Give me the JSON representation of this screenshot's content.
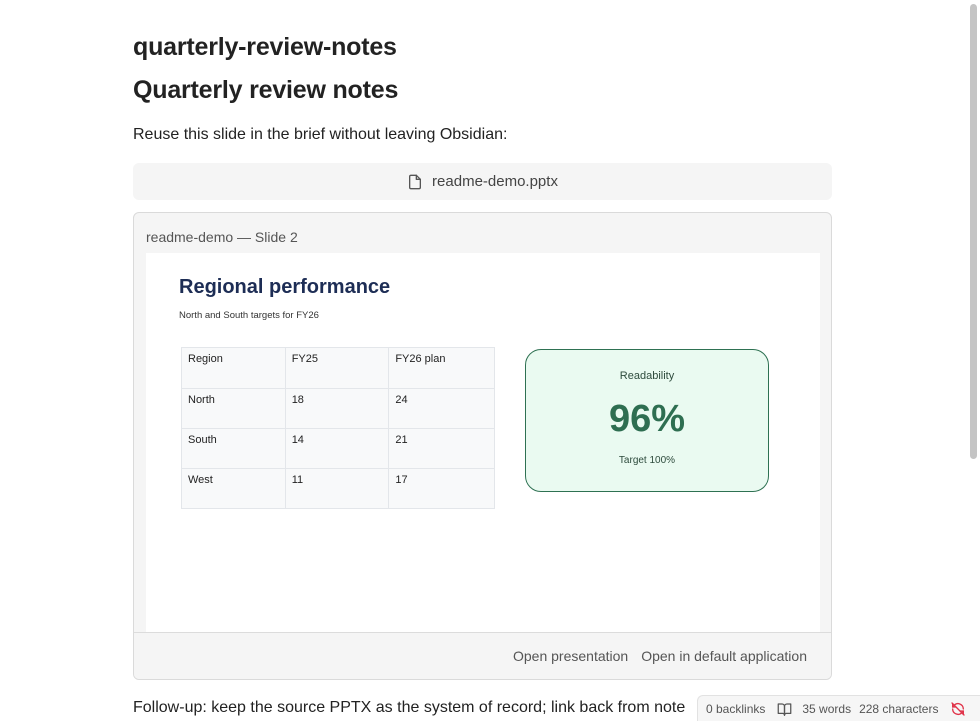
{
  "note": {
    "file_title": "quarterly-review-notes",
    "heading": "Quarterly review notes",
    "intro": "Reuse this slide in the brief without leaving Obsidian:",
    "attachment": {
      "filename": "readme-demo.pptx",
      "icon": "file-icon"
    },
    "followup": "Follow-up: keep the source PPTX as the system of record; link back from note"
  },
  "preview": {
    "label": "readme-demo — Slide 2",
    "slide": {
      "title": "Regional performance",
      "subtitle": "North and South targets for FY26",
      "table": {
        "headers": [
          "Region",
          "FY25",
          "FY26 plan"
        ],
        "rows": [
          [
            "North",
            "18",
            "24"
          ],
          [
            "South",
            "14",
            "21"
          ],
          [
            "West",
            "11",
            "17"
          ]
        ]
      },
      "kpi": {
        "label": "Readability",
        "value": "96%",
        "target": "Target 100%",
        "accent": "#2e6e51",
        "background": "#eafaf1"
      }
    },
    "actions": {
      "open_presentation": "Open presentation",
      "open_default": "Open in default application"
    }
  },
  "status_bar": {
    "backlinks": "0 backlinks",
    "words": "35 words",
    "characters": "228 characters",
    "reading_icon": "book-open-icon",
    "sync_icon": "sync-off-icon",
    "sync_color": "#e0344a"
  }
}
